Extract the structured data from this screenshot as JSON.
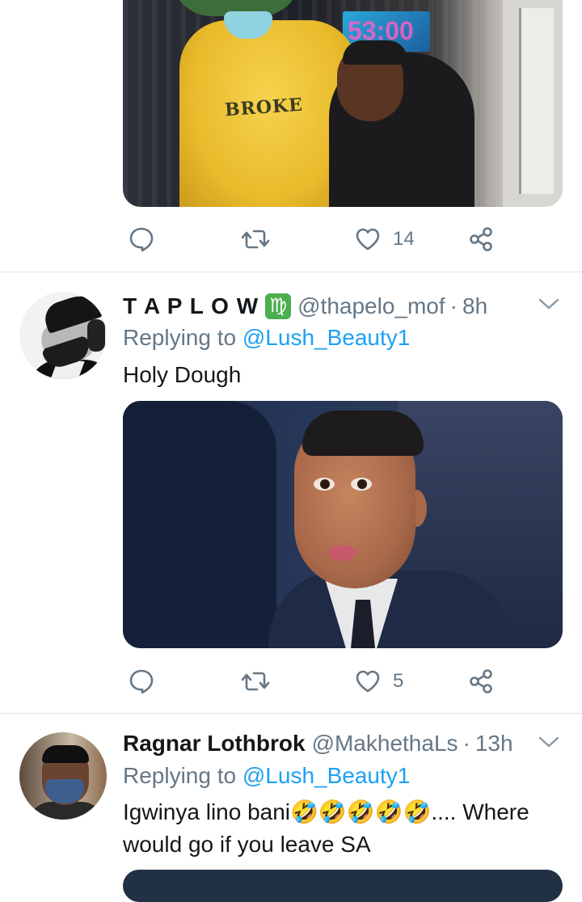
{
  "tweet_prev": {
    "actions": {
      "reply_count": "",
      "retweet_count": "",
      "like_count": "14"
    }
  },
  "tweet1": {
    "display_name": "T A P L O W",
    "badge_glyph": "♍",
    "handle": "@thapelo_mof",
    "separator": "·",
    "time": "8h",
    "replying_prefix": "Replying to",
    "replying_to": "@Lush_Beauty1",
    "text": "Holy Dough",
    "actions": {
      "reply_count": "",
      "retweet_count": "",
      "like_count": "5"
    }
  },
  "tweet2": {
    "display_name": "Ragnar Lothbrok",
    "handle": "@MakhethaLs",
    "separator": "·",
    "time": "13h",
    "replying_prefix": "Replying to",
    "replying_to": "@Lush_Beauty1",
    "text": "Igwinya lino bani🤣🤣🤣🤣🤣.... Where would go if you leave SA"
  },
  "colors": {
    "text": "#14171a",
    "secondary": "#657786",
    "link": "#1da1f2",
    "badge": "#4cae4f",
    "divider": "#dbe1e5"
  },
  "icons": [
    "reply-icon",
    "retweet-icon",
    "heart-icon",
    "share-icon",
    "chevron-down-icon",
    "virgo-badge-icon"
  ]
}
